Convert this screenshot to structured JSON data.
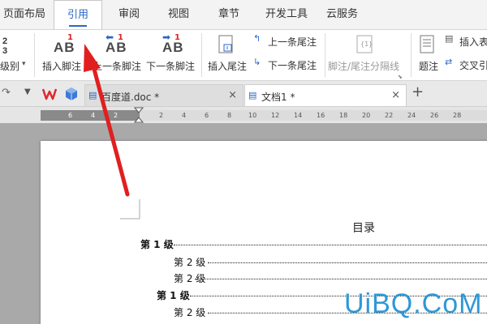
{
  "menu": {
    "tabs": [
      {
        "label": "页面布局"
      },
      {
        "label": "引用"
      },
      {
        "label": "审阅"
      },
      {
        "label": "视图"
      },
      {
        "label": "章节"
      },
      {
        "label": "开发工具"
      },
      {
        "label": "云服务"
      }
    ],
    "active_tab": "引用"
  },
  "ribbon": {
    "level_label": "级别",
    "insert_footnote": {
      "label": "插入脚注",
      "icon_text": "AB",
      "sup": "1"
    },
    "prev_footnote": {
      "label": "上一条脚注",
      "icon_text": "AB",
      "sup": "1"
    },
    "next_footnote": {
      "label": "下一条脚注",
      "icon_text": "AB",
      "sup": "1"
    },
    "insert_endnote": {
      "label": "插入尾注"
    },
    "prev_endnote": {
      "label": "上一条尾注"
    },
    "next_endnote": {
      "label": "下一条尾注"
    },
    "separator": {
      "label": "脚注/尾注分隔线",
      "icon_text": "{1}"
    },
    "caption": {
      "label": "题注"
    },
    "insert_table": {
      "label": "插入表"
    },
    "cross_ref": {
      "label": "交叉引"
    }
  },
  "doc_tabs": [
    {
      "label": "百度道.doc *",
      "close": "×"
    },
    {
      "label": "文档1 *",
      "close": "×"
    }
  ],
  "ruler": {
    "labels": [
      "6",
      "4",
      "2",
      "2",
      "4",
      "6",
      "8",
      "10",
      "12",
      "14",
      "16",
      "18",
      "20",
      "22",
      "24",
      "26",
      "28"
    ]
  },
  "document": {
    "toc_title": "目录",
    "toc": [
      {
        "text": "第 1 级",
        "level": 1
      },
      {
        "text": "第 2 级",
        "level": 2
      },
      {
        "text": "第 2 级",
        "level": 2
      },
      {
        "text": "第 1 级",
        "level": 1
      },
      {
        "text": "第 2 级",
        "level": 2
      }
    ]
  },
  "watermark": "UiBQ.CoM",
  "colors": {
    "accent": "#2a66c8",
    "arrow": "#e11f1f",
    "wps_red": "#e0262b",
    "watermark": "#2e98d6"
  }
}
